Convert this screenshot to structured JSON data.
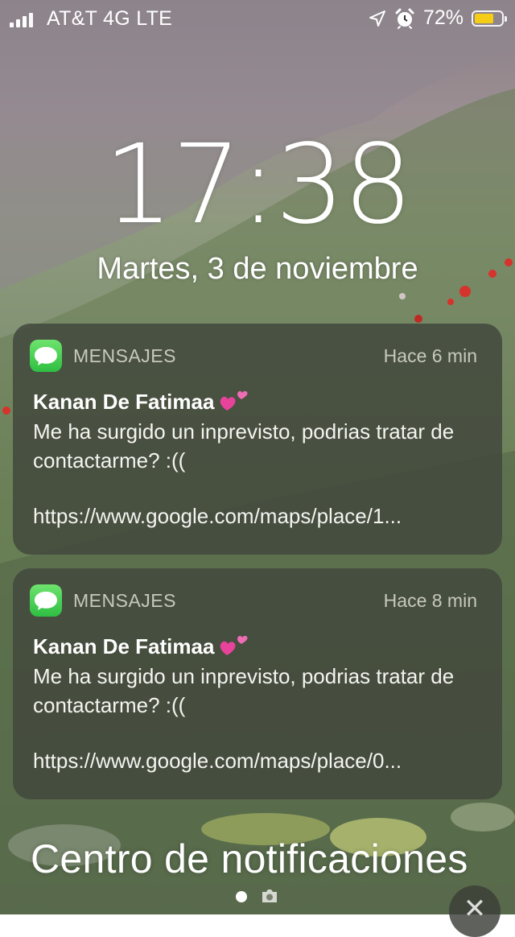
{
  "status_bar": {
    "carrier": "AT&T 4G  LTE",
    "battery_percent": "72%",
    "battery_level": 0.72,
    "icons": [
      "signal-bars-icon",
      "location-arrow-icon",
      "alarm-clock-icon",
      "battery-icon"
    ]
  },
  "lock": {
    "time": "17:38",
    "date": "Martes, 3 de noviembre"
  },
  "notifications": [
    {
      "app": "MENSAJES",
      "time": "Hace 6 min",
      "sender": "Kanan De Fatimaa",
      "message": "Me ha surgido un inprevisto, podrias tratar de contactarme? :((",
      "link": "https://www.google.com/maps/place/1..."
    },
    {
      "app": "MENSAJES",
      "time": "Hace 8 min",
      "sender": "Kanan De Fatimaa",
      "message": "Me ha surgido un inprevisto, podrias tratar de contactarme? :((",
      "link": "https://www.google.com/maps/place/0..."
    }
  ],
  "notification_center": {
    "title": "Centro de notificaciones"
  },
  "colors": {
    "battery_fill": "#f5cc16",
    "messages_icon": "#34c759",
    "card_background": "#42483c"
  }
}
